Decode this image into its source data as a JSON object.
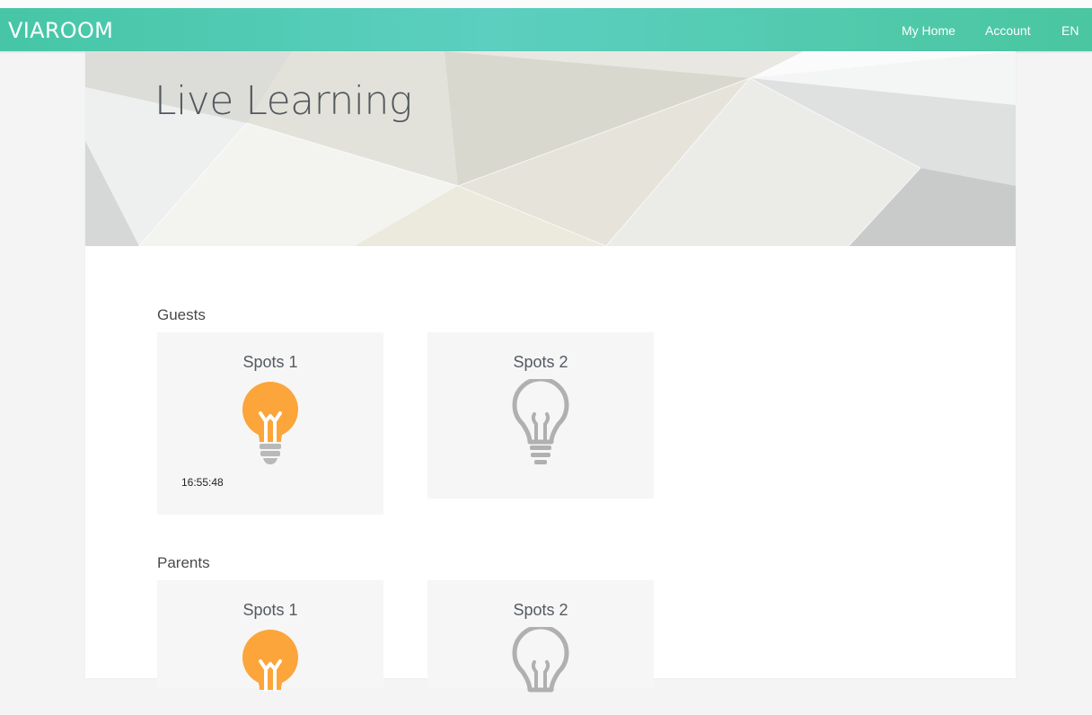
{
  "header": {
    "brand": "VIAROOM",
    "nav": [
      {
        "label": "My Home"
      },
      {
        "label": "Account"
      },
      {
        "label": "EN"
      }
    ]
  },
  "hero": {
    "title": "Live Learning"
  },
  "groups": [
    {
      "title": "Guests",
      "spots": [
        {
          "label": "Spots 1",
          "status": "on",
          "time": "16:55:48"
        },
        {
          "label": "Spots 2",
          "status": "off",
          "time": ""
        }
      ]
    },
    {
      "title": "Parents",
      "spots": [
        {
          "label": "Spots 1",
          "status": "on",
          "time": ""
        },
        {
          "label": "Spots 2",
          "status": "off",
          "time": ""
        }
      ]
    }
  ],
  "colors": {
    "navbar": "#4cc9b0",
    "bulb_on": "#fba53a",
    "bulb_off": "#b0b0b0",
    "bulb_base": "#b9b9b9"
  }
}
